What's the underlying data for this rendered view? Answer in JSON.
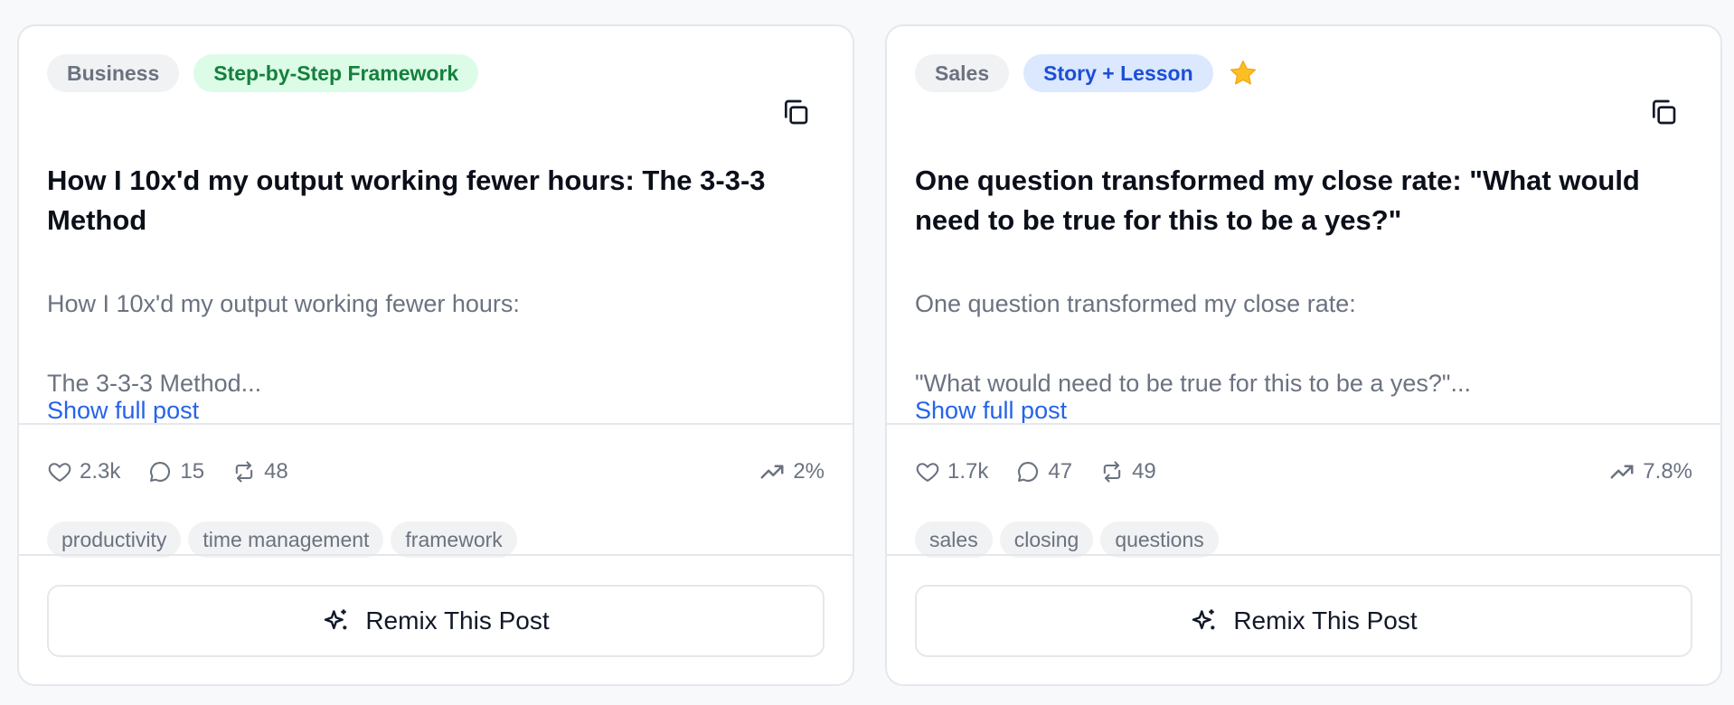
{
  "cards": [
    {
      "category": "Business",
      "format": "Step-by-Step Framework",
      "format_color": "#15803d",
      "starred": false,
      "title": "How I 10x'd my output working fewer hours: The 3-3-3 Method",
      "excerpt_line1": "How I 10x'd my output working fewer hours:",
      "excerpt_line2": "The 3-3-3 Method...",
      "show_more": "Show full post",
      "likes": "2.3k",
      "comments": "15",
      "reposts": "48",
      "growth": "2%",
      "tags": [
        "productivity",
        "time management",
        "framework"
      ],
      "remix_label": "Remix This Post"
    },
    {
      "category": "Sales",
      "format": "Story + Lesson",
      "format_color": "#1d4ed8",
      "starred": true,
      "title": "One question transformed my close rate: \"What would need to be true for this to be a yes?\"",
      "excerpt_line1": "One question transformed my close rate:",
      "excerpt_line2": "\"What would need to be true for this to be a yes?\"...",
      "show_more": "Show full post",
      "likes": "1.7k",
      "comments": "47",
      "reposts": "49",
      "growth": "7.8%",
      "tags": [
        "sales",
        "closing",
        "questions"
      ],
      "remix_label": "Remix This Post"
    }
  ],
  "icons": {
    "copy": "copy-icon",
    "star": "star-icon",
    "like": "heart-icon",
    "comment": "comment-icon",
    "repost": "repost-icon",
    "growth": "trending-up-icon",
    "remix": "sparkles-icon"
  },
  "colors": {
    "link": "#2563eb",
    "star": "#fbbf24",
    "border": "#e5e7eb",
    "muted_text": "#6b7280"
  }
}
